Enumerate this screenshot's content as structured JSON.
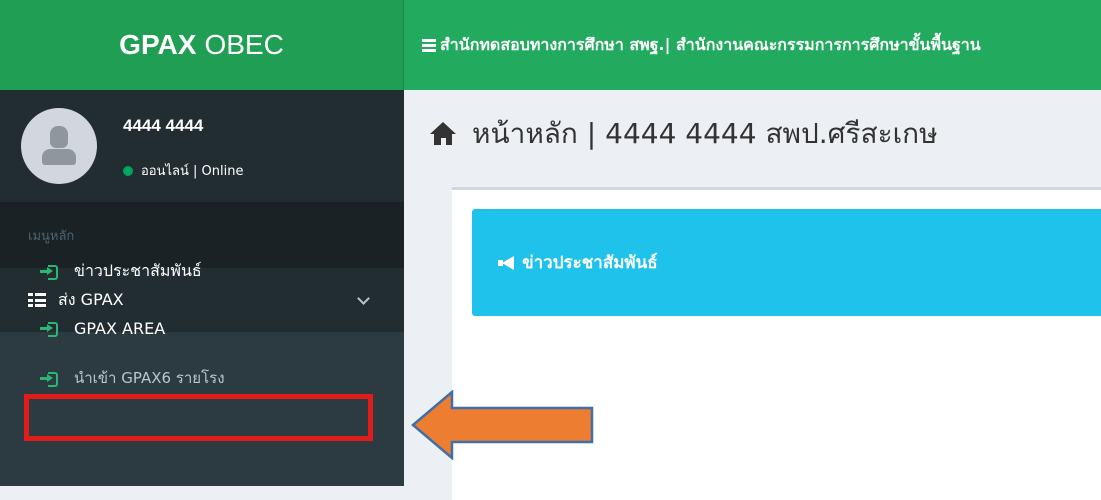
{
  "header": {
    "brand_bold": "GPAX",
    "brand_light": "OBEC",
    "title": "สำนักทดสอบทางการศึกษา สพฐ.| สำนักงานคณะกรรมการการศึกษาขั้นพื้นฐาน"
  },
  "user": {
    "name": "4444 4444",
    "status": "ออนไลน์ | Online",
    "status_color": "#00a65a"
  },
  "sidebar": {
    "section_header": "เมนูหลัก",
    "menu": {
      "label": "ส่ง GPAX",
      "expanded": true,
      "items": [
        {
          "label": "ข่าวประชาสัมพันธ์"
        },
        {
          "label": "GPAX AREA",
          "highlighted": true
        },
        {
          "label": "นำเข้า GPAX6 รายโรง"
        }
      ]
    }
  },
  "content": {
    "title": "หน้าหลัก | 4444 4444  สพป.ศรีสะเกษ",
    "banner": "ข่าวประชาสัมพันธ์"
  },
  "colors": {
    "header_green": "#22aa5e",
    "logo_green": "#1f9e54",
    "sidebar_dark": "#222d32",
    "banner_cyan": "#1ec2eb",
    "highlight_red": "#e21b1b",
    "arrow_orange": "#ed7d31"
  },
  "icons": [
    "bars-icon",
    "user-icon",
    "list-icon",
    "chevron-down-icon",
    "sign-in-icon",
    "home-icon",
    "bullhorn-icon",
    "arrow-left-icon"
  ]
}
